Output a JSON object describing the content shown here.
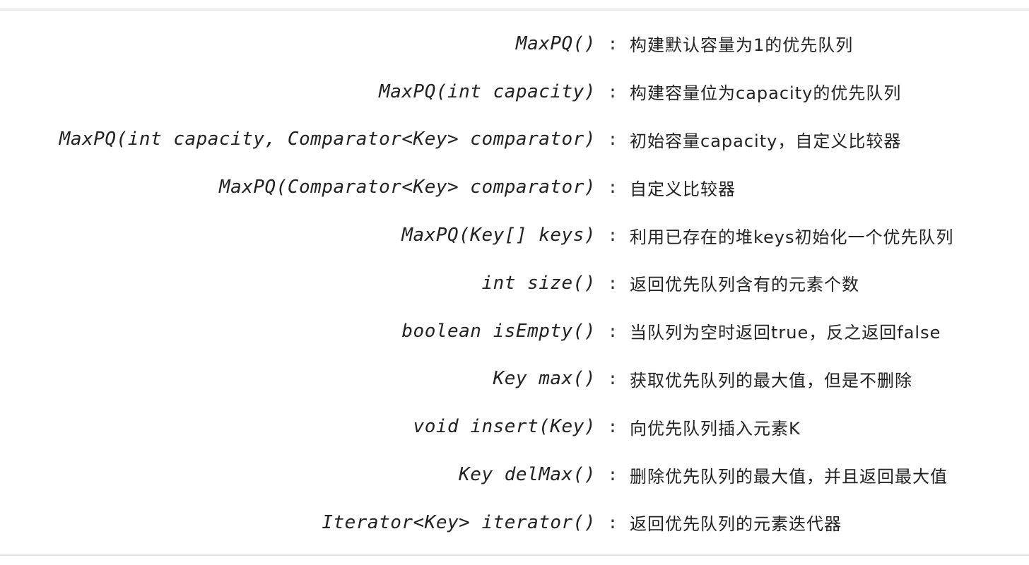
{
  "separator": ":",
  "methods": [
    {
      "signature": "MaxPQ()",
      "description": "构建默认容量为1的优先队列"
    },
    {
      "signature": "MaxPQ(int capacity)",
      "description": "构建容量位为capacity的优先队列"
    },
    {
      "signature": "MaxPQ(int capacity, Comparator<Key> comparator)",
      "description": "初始容量capacity，自定义比较器"
    },
    {
      "signature": "MaxPQ(Comparator<Key> comparator)",
      "description": "自定义比较器"
    },
    {
      "signature": "MaxPQ(Key[] keys)",
      "description": "利用已存在的堆keys初始化一个优先队列"
    },
    {
      "signature": "int size()",
      "description": "返回优先队列含有的元素个数"
    },
    {
      "signature": "boolean isEmpty()",
      "description": "当队列为空时返回true，反之返回false"
    },
    {
      "signature": "Key max()",
      "description": "获取优先队列的最大值，但是不删除"
    },
    {
      "signature": "void insert(Key)",
      "description": "向优先队列插入元素K"
    },
    {
      "signature": "Key delMax()",
      "description": "删除优先队列的最大值，并且返回最大值"
    },
    {
      "signature": "Iterator<Key> iterator()",
      "description": "返回优先队列的元素迭代器"
    }
  ]
}
